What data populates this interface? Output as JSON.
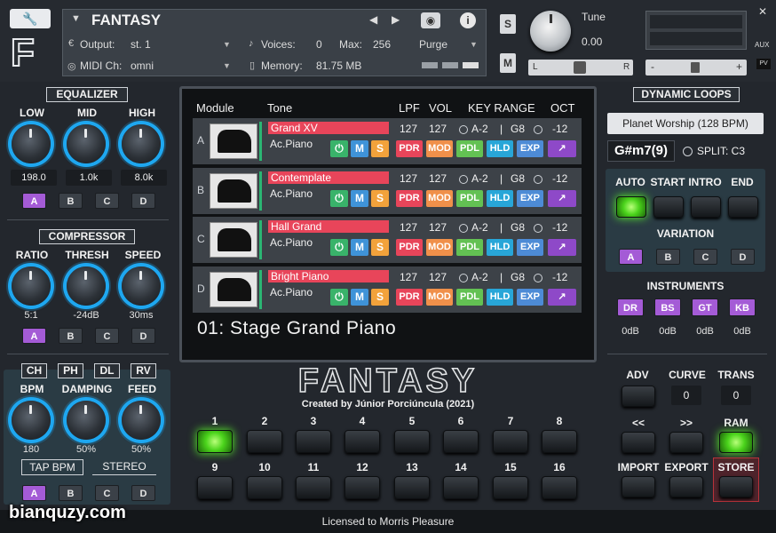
{
  "header": {
    "instrument_name": "FANTASY",
    "output_label": "Output:",
    "output_value": "st. 1",
    "midi_label": "MIDI Ch:",
    "midi_value": "omni",
    "voices_label": "Voices:",
    "voices_value": "0",
    "max_label": "Max:",
    "max_value": "256",
    "memory_label": "Memory:",
    "memory_value": "81.75 MB",
    "purge_label": "Purge",
    "s_label": "S",
    "m_label": "M",
    "tune_label": "Tune",
    "tune_value": "0.00",
    "l_label": "L",
    "r_label": "R",
    "aux_label": "AUX",
    "pv_label": "PV",
    "minus": "-",
    "plus": "+",
    "logo": "F"
  },
  "equalizer": {
    "title": "EQUALIZER",
    "labels": [
      "LOW",
      "MID",
      "HIGH"
    ],
    "values": [
      "198.0",
      "1.0k",
      "8.0k"
    ],
    "ab": [
      "A",
      "B",
      "C",
      "D"
    ]
  },
  "compressor": {
    "title": "COMPRESSOR",
    "labels": [
      "RATIO",
      "THRESH",
      "SPEED"
    ],
    "values": [
      "5:1",
      "-24dB",
      "30ms"
    ],
    "ab": [
      "A",
      "B",
      "C",
      "D"
    ]
  },
  "fx": {
    "tabs": [
      "CH",
      "PH",
      "DL",
      "RV"
    ],
    "labels": [
      "BPM",
      "DAMPING",
      "FEED"
    ],
    "values": [
      "180",
      "50%",
      "50%"
    ],
    "tap_bpm": "TAP BPM",
    "stereo": "STEREO",
    "ab": [
      "A",
      "B",
      "C",
      "D"
    ]
  },
  "screen": {
    "headers": {
      "module": "Module",
      "tone": "Tone",
      "lpf": "LPF",
      "vol": "VOL",
      "key_range": "KEY RANGE",
      "oct": "OCT"
    },
    "rows": [
      {
        "module": "A",
        "name": "Grand XV",
        "tone": "Ac.Piano",
        "lpf": "127",
        "vol": "127",
        "key_lo": "A-2",
        "sep": "|",
        "key_hi": "G8",
        "oct": "-12"
      },
      {
        "module": "B",
        "name": "Contemplate",
        "tone": "Ac.Piano",
        "lpf": "127",
        "vol": "127",
        "key_lo": "A-2",
        "sep": "|",
        "key_hi": "G8",
        "oct": "-12"
      },
      {
        "module": "C",
        "name": "Hall Grand",
        "tone": "Ac.Piano",
        "lpf": "127",
        "vol": "127",
        "key_lo": "A-2",
        "sep": "|",
        "key_hi": "G8",
        "oct": "-12"
      },
      {
        "module": "D",
        "name": "Bright Piano",
        "tone": "Ac.Piano",
        "lpf": "127",
        "vol": "127",
        "key_lo": "A-2",
        "sep": "|",
        "key_hi": "G8",
        "oct": "-12"
      }
    ],
    "row_buttons": {
      "m": "M",
      "s": "S",
      "pdr": "PDR",
      "mod": "MOD",
      "pdl": "PDL",
      "hld": "HLD",
      "exp": "EXP"
    },
    "preset": "01: Stage Grand Piano"
  },
  "brand": {
    "title": "FANTASY",
    "credit": "Created by Júnior Porciúncula (2021)"
  },
  "pads": {
    "row1": [
      "1",
      "2",
      "3",
      "4",
      "5",
      "6",
      "7",
      "8"
    ],
    "row2": [
      "9",
      "10",
      "11",
      "12",
      "13",
      "14",
      "15",
      "16"
    ]
  },
  "dynamic_loops": {
    "title": "DYNAMIC LOOPS",
    "loop": "Planet Worship (128 BPM)",
    "chord": "G#m7(9)",
    "split": "SPLIT: C3",
    "controls": [
      "AUTO",
      "START",
      "INTRO",
      "END"
    ],
    "variation_label": "VARIATION",
    "variation": [
      "A",
      "B",
      "C",
      "D"
    ]
  },
  "instruments": {
    "title": "INSTRUMENTS",
    "items": [
      "DR",
      "BS",
      "GT",
      "KB"
    ],
    "levels": [
      "0dB",
      "0dB",
      "0dB",
      "0dB"
    ]
  },
  "controls": {
    "adv": "ADV",
    "curve": "CURVE",
    "curve_value": "0",
    "trans": "TRANS",
    "trans_value": "0",
    "prev": "<<",
    "next": ">>",
    "ram": "RAM",
    "import": "IMPORT",
    "export": "EXPORT",
    "store": "STORE"
  },
  "footer": {
    "license": "Licensed to Morris Pleasure",
    "watermark": "bianquzy.com"
  },
  "colors": {
    "accent_purple": "#a45bd6",
    "knob_ring": "#1ea7f0",
    "row_name_red": "#e8455a",
    "led_green": "#4bd41c"
  }
}
